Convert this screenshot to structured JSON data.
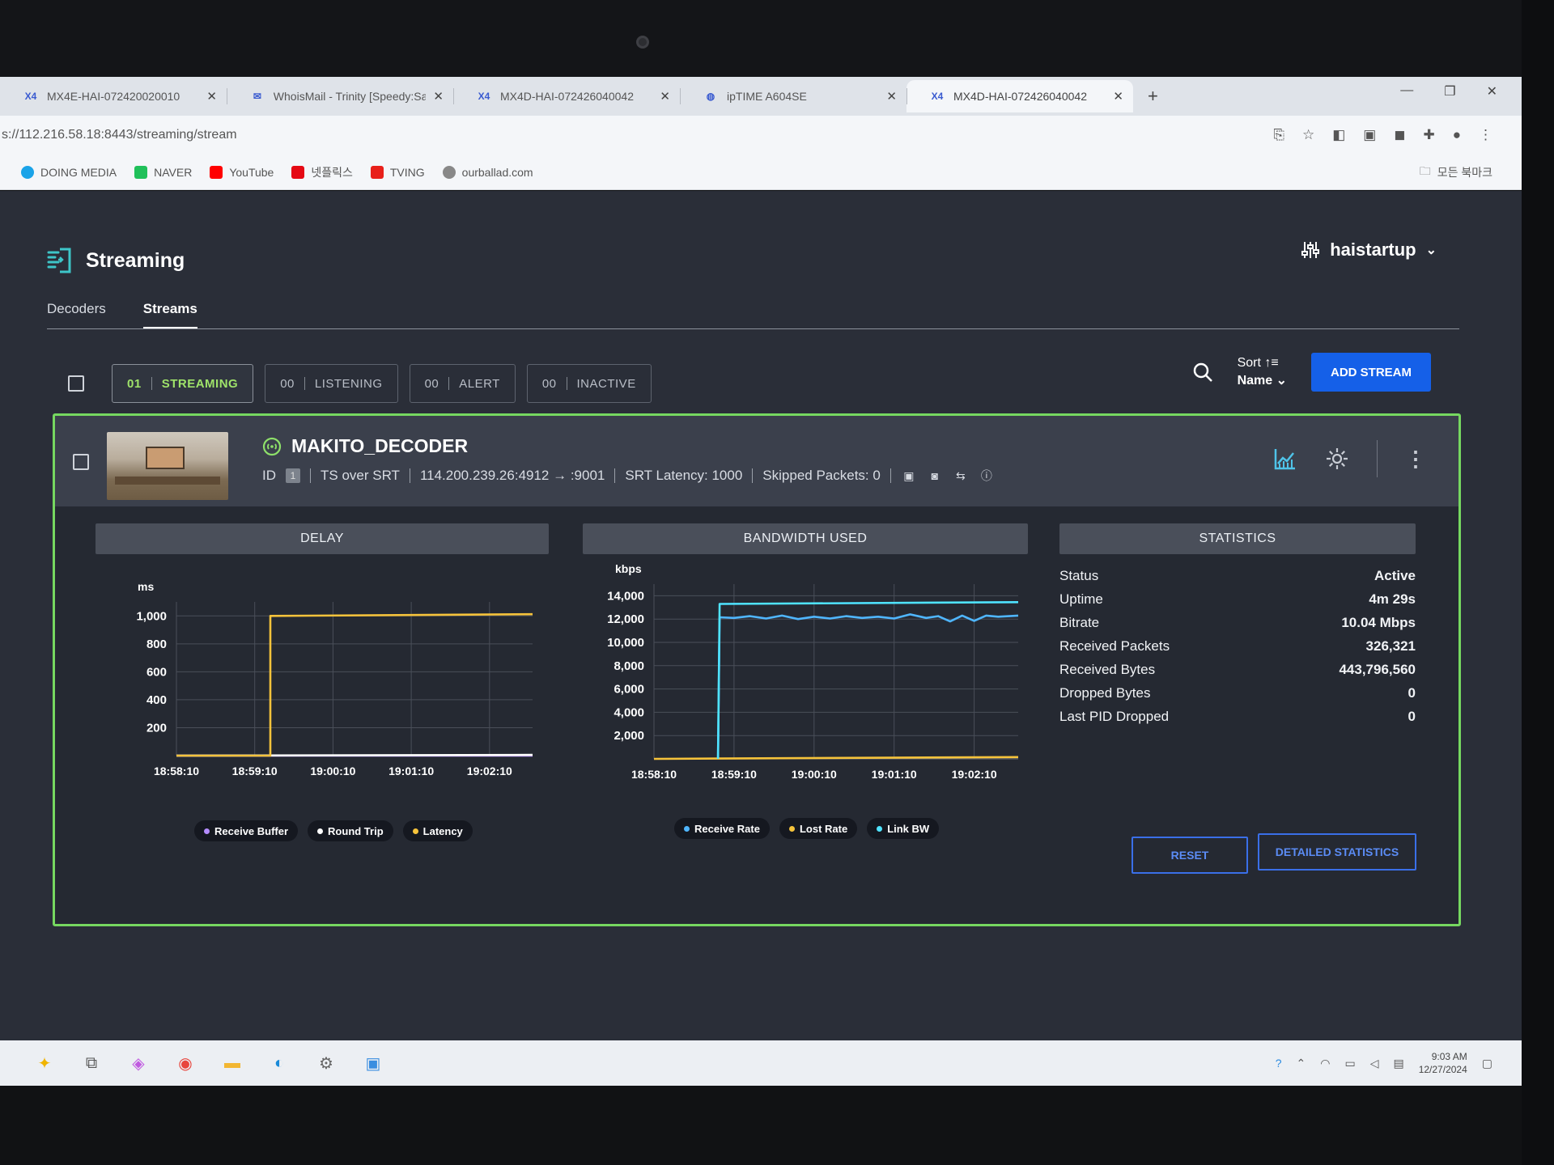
{
  "browser": {
    "tabs": [
      {
        "icon": "X4",
        "title": "MX4E-HAI-072420020010",
        "active": false
      },
      {
        "icon": "mail",
        "title": "WhoisMail - Trinity [Speedy:Sa",
        "active": false
      },
      {
        "icon": "X4",
        "title": "MX4D-HAI-072426040042",
        "active": false
      },
      {
        "icon": "globe",
        "title": "ipTIME A604SE",
        "active": false
      },
      {
        "icon": "X4",
        "title": "MX4D-HAI-072426040042",
        "active": true
      }
    ],
    "url": "s://112.216.58.18:8443/streaming/stream",
    "bookmarks": [
      {
        "label": "DOING MEDIA",
        "color": "#1aa3e8"
      },
      {
        "label": "NAVER",
        "color": "#20c05a"
      },
      {
        "label": "YouTube",
        "color": "#ff0000"
      },
      {
        "label": "넷플릭스",
        "color": "#e50914"
      },
      {
        "label": "TVING",
        "color": "#e8201a"
      },
      {
        "label": "ourballad.com",
        "color": "#888888"
      }
    ],
    "all_bookmarks": "모든 북마크"
  },
  "app": {
    "title": "Streaming",
    "user": "haistartup",
    "tabs": [
      "Decoders",
      "Streams"
    ],
    "active_tab": "Streams",
    "filters": [
      {
        "count": "01",
        "label": "STREAMING",
        "active": true
      },
      {
        "count": "00",
        "label": "LISTENING",
        "active": false
      },
      {
        "count": "00",
        "label": "ALERT",
        "active": false
      },
      {
        "count": "00",
        "label": "INACTIVE",
        "active": false
      }
    ],
    "sort_label": "Sort",
    "sort_value": "Name",
    "add_stream": "ADD STREAM"
  },
  "stream": {
    "name": "MAKITO_DECODER",
    "id_label": "ID",
    "id_value": "1",
    "protocol": "TS over SRT",
    "address": "114.200.239.26:4912 → :9001",
    "srt_latency": "SRT Latency: 1000",
    "skipped_packets": "Skipped Packets: 0"
  },
  "panels": {
    "delay_title": "DELAY",
    "bandwidth_title": "BANDWIDTH USED",
    "statistics_title": "STATISTICS"
  },
  "chart_data": [
    {
      "type": "line",
      "title": "DELAY",
      "ylabel": "ms",
      "ylim": [
        0,
        1100
      ],
      "yticks": [
        "1,000",
        "800",
        "600",
        "400",
        "200"
      ],
      "xticks": [
        "18:58:10",
        "18:59:10",
        "19:00:10",
        "19:01:10",
        "19:02:10"
      ],
      "x_range": [
        0,
        4.55
      ],
      "series": [
        {
          "name": "Receive Buffer",
          "color": "#b48cff",
          "points": [
            [
              0,
              0
            ],
            [
              4.55,
              0
            ]
          ]
        },
        {
          "name": "Round Trip",
          "color": "#ffffff",
          "points": [
            [
              0,
              0
            ],
            [
              4.55,
              5
            ]
          ]
        },
        {
          "name": "Latency",
          "color": "#f6c33b",
          "points": [
            [
              0,
              0
            ],
            [
              1.2,
              0
            ],
            [
              1.2,
              1000
            ],
            [
              4.55,
              1012
            ]
          ]
        }
      ]
    },
    {
      "type": "line",
      "title": "BANDWIDTH USED",
      "ylabel": "kbps",
      "ylim": [
        0,
        15000
      ],
      "yticks": [
        "14,000",
        "12,000",
        "10,000",
        "8,000",
        "6,000",
        "4,000",
        "2,000"
      ],
      "xticks": [
        "18:58:10",
        "18:59:10",
        "19:00:10",
        "19:01:10",
        "19:02:10"
      ],
      "x_range": [
        0,
        4.55
      ],
      "series": [
        {
          "name": "Receive Rate",
          "color": "#4fb6ff",
          "points": [
            [
              0.8,
              0
            ],
            [
              0.82,
              12150
            ],
            [
              1.0,
              12100
            ],
            [
              1.2,
              12250
            ],
            [
              1.4,
              12050
            ],
            [
              1.6,
              12300
            ],
            [
              1.8,
              12000
            ],
            [
              2.0,
              12200
            ],
            [
              2.2,
              12050
            ],
            [
              2.4,
              12250
            ],
            [
              2.6,
              12100
            ],
            [
              2.8,
              12200
            ],
            [
              3.0,
              12050
            ],
            [
              3.2,
              12400
            ],
            [
              3.4,
              12100
            ],
            [
              3.55,
              12250
            ],
            [
              3.7,
              11800
            ],
            [
              3.85,
              12300
            ],
            [
              4.0,
              11850
            ],
            [
              4.15,
              12300
            ],
            [
              4.3,
              12200
            ],
            [
              4.55,
              12300
            ]
          ]
        },
        {
          "name": "Lost Rate",
          "color": "#f6c33b",
          "points": [
            [
              0,
              0
            ],
            [
              4.55,
              150
            ]
          ]
        },
        {
          "name": "Link BW",
          "color": "#4fe3ff",
          "points": [
            [
              0.8,
              0
            ],
            [
              0.82,
              13300
            ],
            [
              4.55,
              13450
            ]
          ]
        }
      ]
    }
  ],
  "statistics": [
    {
      "label": "Status",
      "value": "Active"
    },
    {
      "label": "Uptime",
      "value": "4m 29s"
    },
    {
      "label": "Bitrate",
      "value": "10.04 Mbps"
    },
    {
      "label": "Received Packets",
      "value": "326,321"
    },
    {
      "label": "Received Bytes",
      "value": "443,796,560"
    },
    {
      "label": "Dropped Bytes",
      "value": "0"
    },
    {
      "label": "Last PID Dropped",
      "value": "0"
    }
  ],
  "buttons": {
    "reset": "RESET",
    "detailed": "DETAILED STATISTICS"
  },
  "taskbar": {
    "time": "9:03 AM",
    "date": "12/27/2024"
  }
}
